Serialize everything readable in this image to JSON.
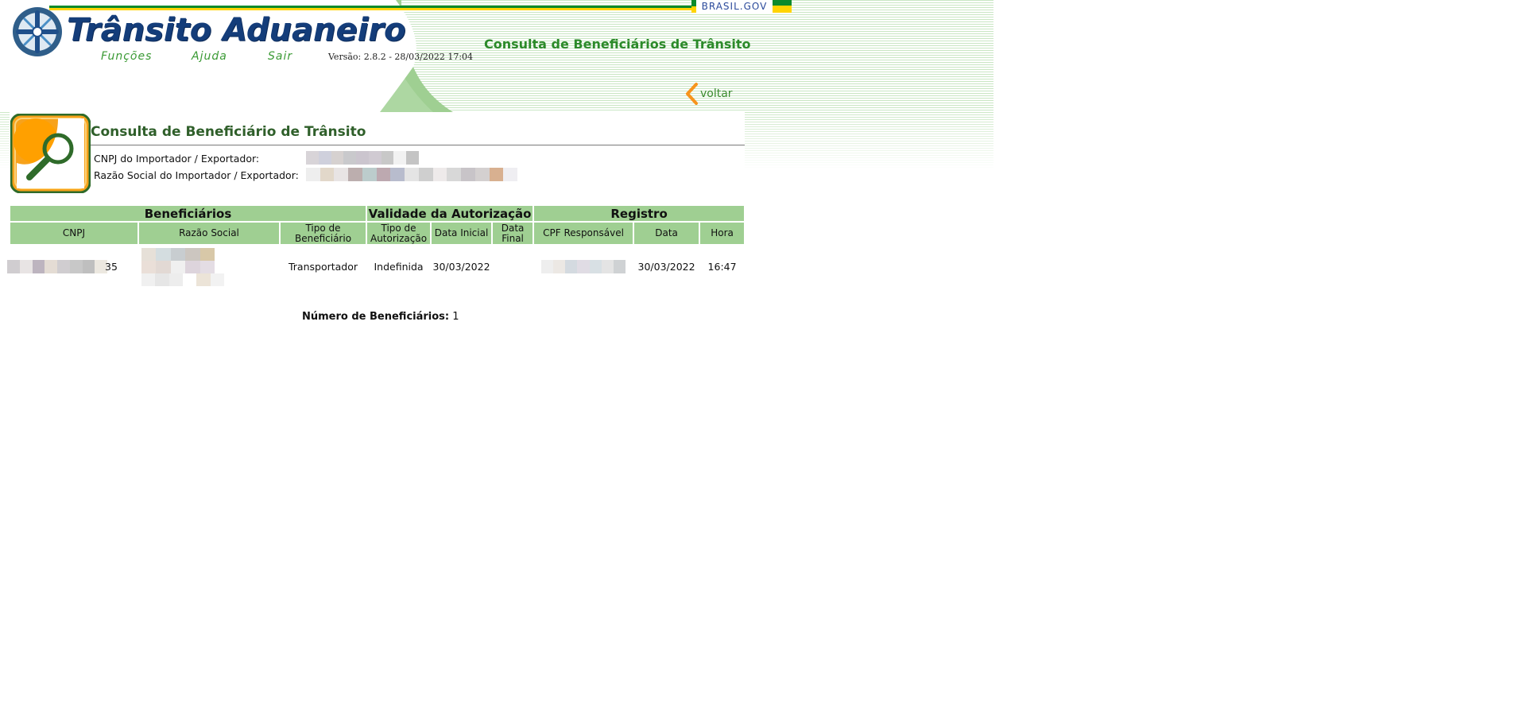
{
  "header": {
    "brasil_gov": "BRASIL.GOV",
    "app_title": "Trânsito Aduaneiro",
    "nav": {
      "funcoes": "Funções",
      "ajuda": "Ajuda",
      "sair": "Sair"
    },
    "version": "Versão: 2.8.2 - 28/03/2022 17:04",
    "page_heading": "Consulta de Beneficiários de Trânsito",
    "back_label": "voltar"
  },
  "panel": {
    "title": "Consulta de Beneficiário de Trânsito",
    "cnpj_label": "CNPJ do Importador / Exportador:",
    "razao_label": "Razão Social do Importador / Exportador:"
  },
  "table": {
    "group_headers": {
      "beneficiarios": "Beneficiários",
      "validade": "Validade da Autorização",
      "registro": "Registro"
    },
    "columns": {
      "cnpj": "CNPJ",
      "razao_social": "Razão Social",
      "tipo_beneficiario": "Tipo de Beneficiário",
      "tipo_autorizacao": "Tipo de Autorização",
      "data_inicial": "Data Inicial",
      "data_final": "Data Final",
      "cpf_responsavel": "CPF Responsável",
      "data": "Data",
      "hora": "Hora"
    },
    "rows": [
      {
        "cnpj_tail": "35",
        "tipo_beneficiario": "Transportador",
        "tipo_autorizacao": "Indefinida",
        "data_inicial": "30/03/2022",
        "data_final": "",
        "data": "30/03/2022",
        "hora": "16:47"
      }
    ]
  },
  "footer": {
    "count_label": "Número de Beneficiários:",
    "count_value": "1"
  },
  "colors": {
    "header_green": "#2c8a2a",
    "table_header_bg": "#9fcf92",
    "title_blue": "#143d7a",
    "nav_green": "#3a9a34",
    "accent_orange": "#f7a21b"
  }
}
